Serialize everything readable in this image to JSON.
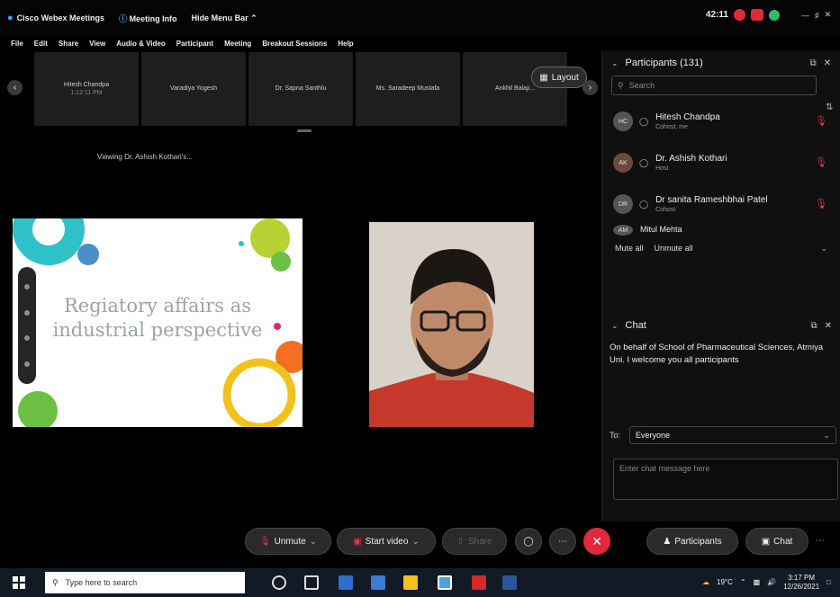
{
  "titlebar": {
    "app_name": "Cisco Webex Meetings",
    "meeting_info": "Meeting Info",
    "hide_menu_bar": "Hide Menu Bar",
    "timer": "42:11"
  },
  "menubar": [
    "File",
    "Edit",
    "Share",
    "View",
    "Audio & Video",
    "Participant",
    "Meeting",
    "Breakout Sessions",
    "Help"
  ],
  "strip": {
    "thumbnails": [
      {
        "name": "Hitesh Chandpa",
        "sub": "1:12:11 PM"
      },
      {
        "name": "Varadiya Yogesh",
        "sub": ""
      },
      {
        "name": "Dr. Sapna Santhlu",
        "sub": ""
      },
      {
        "name": "Ms. Saradeep Mustafa",
        "sub": ""
      },
      {
        "name": "Ankhil Balaji...",
        "sub": ""
      }
    ],
    "layout_label": "Layout",
    "viewing_text": "Viewing Dr. Ashish Kothari's..."
  },
  "slide": {
    "line1": "Regiatory affairs as",
    "line2": "industrial perspective"
  },
  "participants": {
    "header": "Participants (131)",
    "search_placeholder": "Search",
    "list": [
      {
        "initials": "HC",
        "name": "Hitesh Chandpa",
        "sub": "Cohost, me"
      },
      {
        "initials": "AK",
        "name": "Dr. Ashish Kothari",
        "sub": "Host"
      },
      {
        "initials": "DR",
        "name": "Dr sanita Rameshbhai Patel",
        "sub": "Cohost"
      },
      {
        "initials": "AM",
        "name": "Mitul Mehta",
        "sub": ""
      }
    ],
    "mute_all": "Mute all",
    "unmute_all": "Unmute all"
  },
  "chat": {
    "header": "Chat",
    "message": "On behalf of School of Pharmaceutical Sciences, Atmiya Uni. I welcome you all participants",
    "to_label": "To:",
    "to_value": "Everyone",
    "input_placeholder": "Enter chat message here"
  },
  "controls": {
    "unmute": "Unmute",
    "start_video": "Start video",
    "share": "Share",
    "participants": "Participants",
    "chat": "Chat"
  },
  "taskbar": {
    "search_placeholder": "Type here to search",
    "weather": "19°C",
    "time": "3:17 PM",
    "date": "12/26/2021"
  }
}
